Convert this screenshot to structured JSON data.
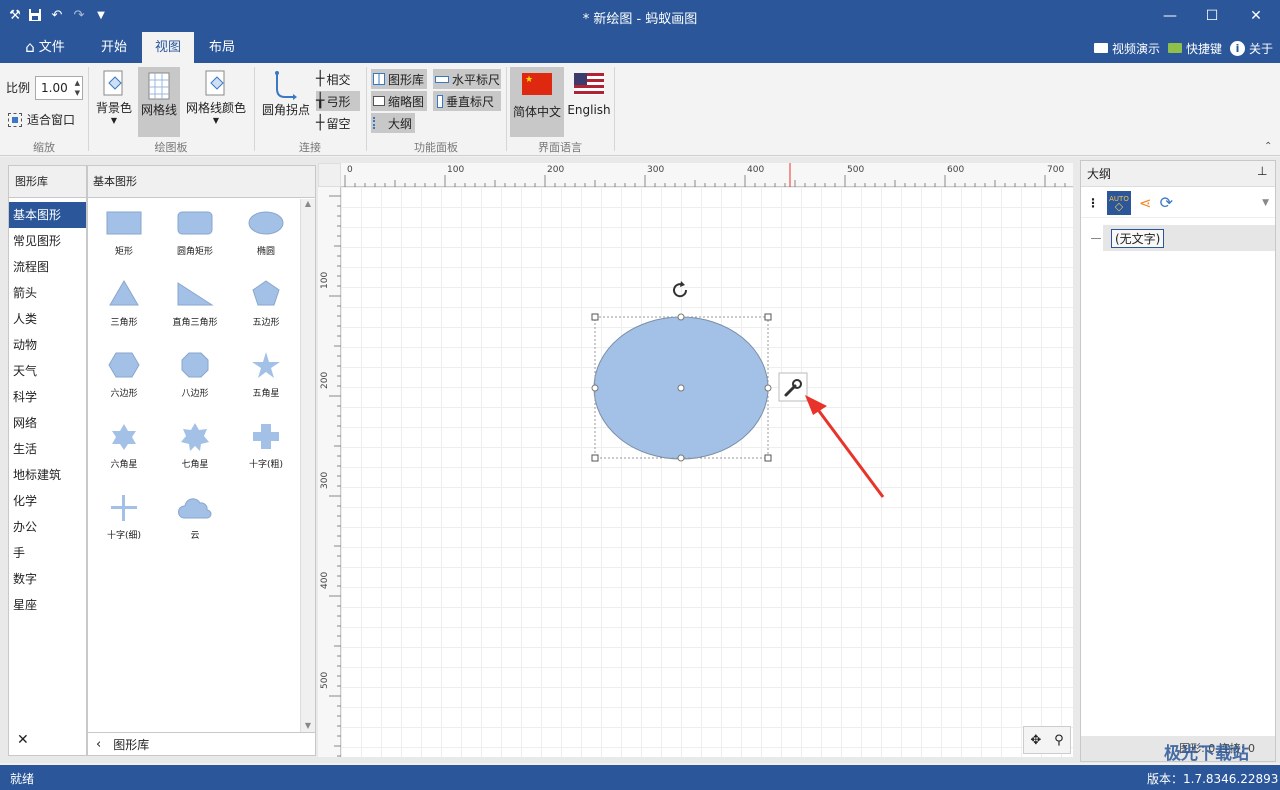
{
  "window": {
    "title": "* 新绘图 - 蚂蚁画图"
  },
  "tabs": [
    {
      "label": "文件"
    },
    {
      "label": "开始"
    },
    {
      "label": "视图"
    },
    {
      "label": "布局"
    }
  ],
  "right_links": {
    "video": "视频演示",
    "shortcuts": "快捷键",
    "about": "关于"
  },
  "ribbon": {
    "zoom": {
      "scale_label": "比例",
      "scale_value": "1.00",
      "fit_label": "适合窗口",
      "group": "缩放"
    },
    "board": {
      "bg_label": "背景色",
      "grid_label": "网格线",
      "grid_color_label": "网格线颜色",
      "group": "绘图板"
    },
    "connect": {
      "round_label": "圆角拐点",
      "cross": "相交",
      "arc": "弓形",
      "gap": "留空",
      "group": "连接"
    },
    "panels": {
      "library": "图形库",
      "hruler": "水平标尺",
      "thumbnail": "缩略图",
      "vruler": "垂直标尺",
      "outline": "大纲",
      "group": "功能面板"
    },
    "lang": {
      "zh": "简体中文",
      "en": "English",
      "group": "界面语言"
    }
  },
  "library": {
    "header": "图形库",
    "section": "基本图形",
    "categories": [
      "基本图形",
      "常见图形",
      "流程图",
      "箭头",
      "人类",
      "动物",
      "天气",
      "科学",
      "网络",
      "生活",
      "地标建筑",
      "化学",
      "办公",
      "手",
      "数字",
      "星座"
    ],
    "shapes": [
      "矩形",
      "圆角矩形",
      "椭圆",
      "三角形",
      "直角三角形",
      "五边形",
      "六边形",
      "八边形",
      "五角星",
      "六角星",
      "七角星",
      "十字(粗)",
      "十字(细)",
      "云"
    ],
    "footer": "图形库",
    "close_glyph": "✕"
  },
  "ruler": {
    "h_ticks": [
      "0",
      "100",
      "200",
      "300",
      "400",
      "500",
      "600",
      "700"
    ],
    "v_ticks": [
      "100",
      "200",
      "300",
      "400",
      "500"
    ]
  },
  "outline": {
    "title": "大纲",
    "node": "(无文字)",
    "auto_badge": "AUTO",
    "footer": "图形: 0  连接: 0"
  },
  "status": {
    "left": "就绪",
    "version": "版本：1.7.8346.22893",
    "watermark": "极光下载站"
  },
  "colors": {
    "brand": "#2b579a",
    "shape_fill": "#a3c1e6",
    "shape_stroke": "#7a8fa8",
    "arrow": "#e8332a"
  }
}
